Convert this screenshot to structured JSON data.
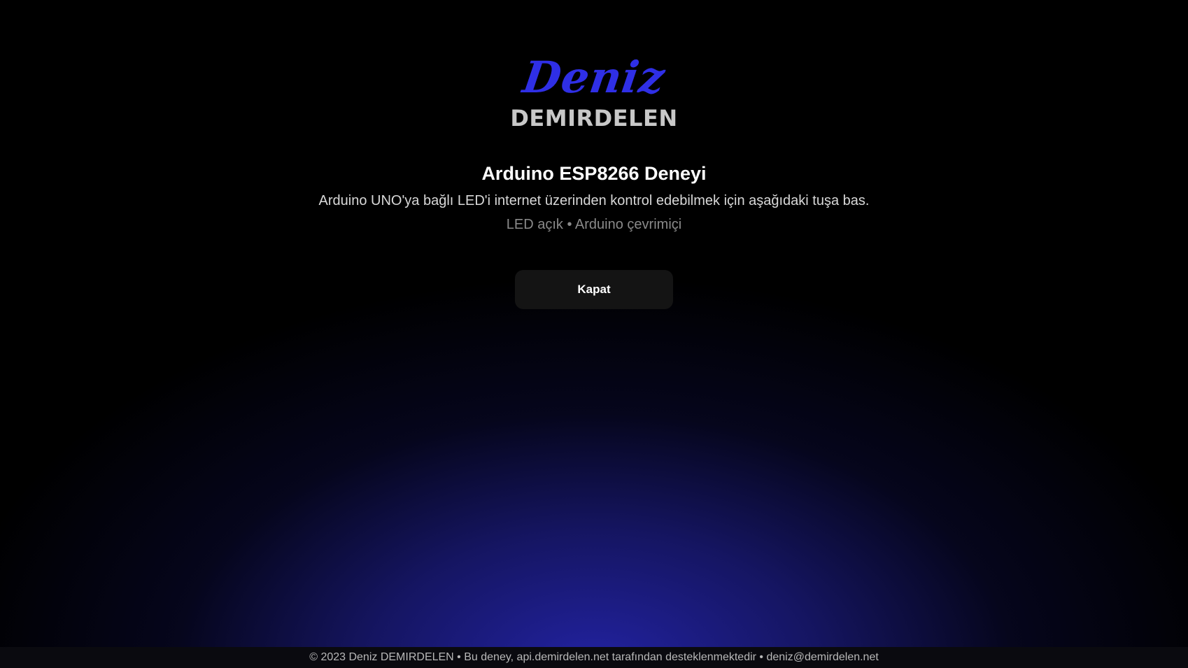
{
  "brand": {
    "logo_script": "Deniz",
    "logo_block": "DEMIRDELEN",
    "script_color": "#2f2fe6",
    "block_color": "#c8c8c8"
  },
  "main": {
    "title": "Arduino ESP8266 Deneyi",
    "description": "Arduino UNO'ya bağlı LED'i internet üzerinden kontrol edebilmek için aşağıdaki tuşa bas.",
    "status": "LED açık • Arduino çevrimiçi",
    "button_label": "Kapat"
  },
  "footer": {
    "text": "© 2023 Deniz DEMIRDELEN • Bu deney, api.demirdelen.net tarafından desteklenmektedir • deniz@demirdelen.net"
  },
  "colors": {
    "background": "#000000",
    "glow": "#2424aa",
    "button_bg": "#141414"
  }
}
